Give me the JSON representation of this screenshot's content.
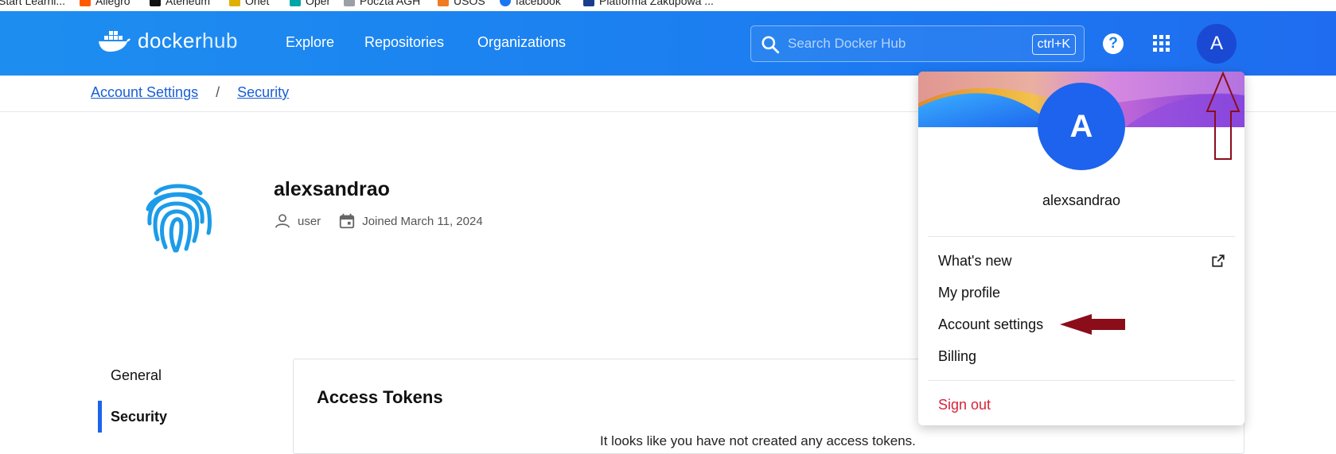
{
  "bookmarks": [
    {
      "label": "Start Learni...",
      "color": "#f5a623"
    },
    {
      "label": "Allegro",
      "color": "#ff5a00"
    },
    {
      "label": "Ateneum",
      "color": "#111111"
    },
    {
      "label": "Onet",
      "color": "#e0b000"
    },
    {
      "label": "Oper",
      "color": "#00a6a6"
    },
    {
      "label": "Poczta AGH",
      "color": "#9aa0a6"
    },
    {
      "label": "USOS",
      "color": "#f07b21"
    },
    {
      "label": "facebook",
      "color": "#1877f2"
    },
    {
      "label": "Platforma Zakupowa ...",
      "color": "#1a3c8c"
    }
  ],
  "header": {
    "logo_docker": "docker",
    "logo_hub": "hub",
    "nav": [
      "Explore",
      "Repositories",
      "Organizations"
    ],
    "search_placeholder": "Search Docker Hub",
    "search_shortcut": "ctrl+K",
    "help_icon": "help-circle-icon",
    "apps_icon": "grid-icon",
    "avatar_letter": "A"
  },
  "breadcrumb": {
    "items": [
      "Account Settings",
      "Security"
    ],
    "separator": "/"
  },
  "profile": {
    "username": "alexsandrao",
    "role": "user",
    "joined": "Joined March 11, 2024"
  },
  "sidenav": {
    "items": [
      "General",
      "Security"
    ],
    "active": "Security"
  },
  "main": {
    "card_title": "Access Tokens",
    "empty_message": "It looks like you have not created any access tokens."
  },
  "user_menu": {
    "avatar_letter": "A",
    "username": "alexsandrao",
    "items": [
      "What's new",
      "My profile",
      "Account settings",
      "Billing"
    ],
    "sign_out": "Sign out"
  },
  "colors": {
    "nav_gradient_start": "#1d8ef0",
    "nav_gradient_end": "#1f6cf0",
    "accent_blue": "#1d63ed",
    "annotation_red": "#8b0d1a",
    "sign_out_red": "#d6243a"
  }
}
